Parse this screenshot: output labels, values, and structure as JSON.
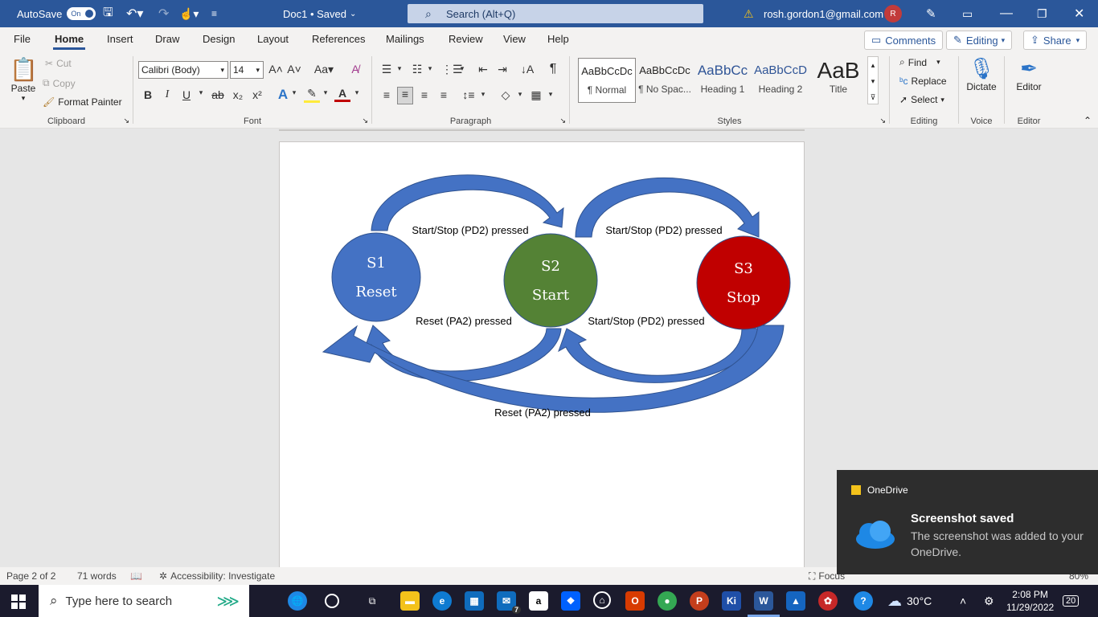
{
  "titlebar": {
    "autosave_label": "AutoSave",
    "autosave_state": "On",
    "doc_title": "Doc1 • Saved",
    "search_placeholder": "Search (Alt+Q)",
    "account_email": "rosh.gordon1@gmail.com",
    "avatar_initial": "R"
  },
  "tabs": [
    "File",
    "Home",
    "Insert",
    "Draw",
    "Design",
    "Layout",
    "References",
    "Mailings",
    "Review",
    "View",
    "Help"
  ],
  "tab_actions": {
    "comments": "Comments",
    "editing": "Editing",
    "share": "Share"
  },
  "clipboard": {
    "paste": "Paste",
    "cut": "Cut",
    "copy": "Copy",
    "format_painter": "Format Painter",
    "group": "Clipboard"
  },
  "font": {
    "family": "Calibri (Body)",
    "size": "14",
    "group": "Font",
    "change_case": "Aa"
  },
  "paragraph": {
    "group": "Paragraph"
  },
  "styles": {
    "items": [
      {
        "preview": "AaBbCcDc",
        "name": "¶ Normal"
      },
      {
        "preview": "AaBbCcDc",
        "name": "¶ No Spac..."
      },
      {
        "preview": "AaBbCc",
        "name": "Heading 1"
      },
      {
        "preview": "AaBbCcD",
        "name": "Heading 2"
      },
      {
        "preview": "AaB",
        "name": "Title"
      }
    ],
    "group": "Styles"
  },
  "editing": {
    "find": "Find",
    "replace": "Replace",
    "select": "Select",
    "group": "Editing"
  },
  "voice": {
    "dictate": "Dictate",
    "group": "Voice"
  },
  "editor": {
    "label": "Editor",
    "group": "Editor"
  },
  "diagram": {
    "states": [
      {
        "id": "S1",
        "name": "Reset",
        "color": "#4472c4"
      },
      {
        "id": "S2",
        "name": "Start",
        "color": "#548235"
      },
      {
        "id": "S3",
        "name": "Stop",
        "color": "#c00000"
      }
    ],
    "arrow_color": "#4472c4",
    "labels": {
      "s1_s2": "Start/Stop (PD2) pressed",
      "s2_s3": "Start/Stop (PD2) pressed",
      "s2_s1": "Reset (PA2) pressed",
      "s3_s2": "Start/Stop (PD2) pressed",
      "s3_s1": "Reset (PA2) pressed"
    }
  },
  "statusbar": {
    "page": "Page 2 of 2",
    "words": "71 words",
    "accessibility": "Accessibility: Investigate",
    "focus": "Focus",
    "zoom": "80%"
  },
  "toast": {
    "app": "OneDrive",
    "title": "Screenshot saved",
    "body": "The screenshot was added to your OneDrive."
  },
  "taskbar": {
    "search_placeholder": "Type here to search",
    "temperature": "30°C",
    "time": "2:08 PM",
    "date": "11/29/2022",
    "notifications": "20",
    "mail_badge": "7"
  }
}
